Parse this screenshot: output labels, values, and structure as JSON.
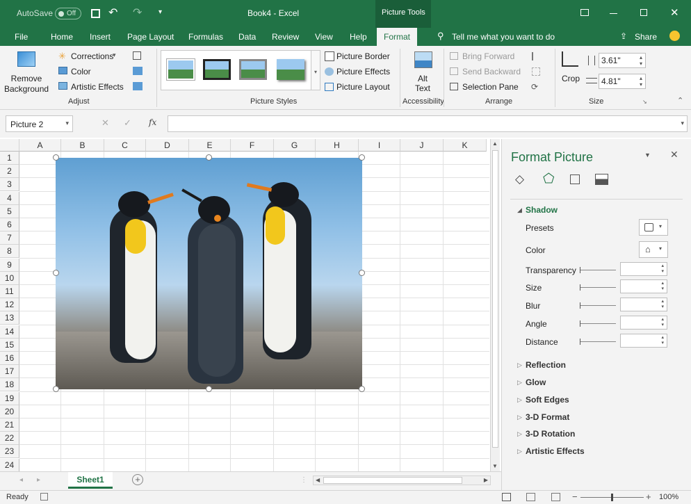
{
  "titlebar": {
    "autosave": "AutoSave",
    "autosave_state": "Off",
    "title": "Book4 - Excel",
    "context_tools": "Picture Tools"
  },
  "tabs": [
    "File",
    "Home",
    "Insert",
    "Page Layout",
    "Formulas",
    "Data",
    "Review",
    "View",
    "Help",
    "Format"
  ],
  "tell_me": "Tell me what you want to do",
  "share": "Share",
  "ribbon": {
    "remove_background": "Remove Background",
    "corrections": "Corrections",
    "color": "Color",
    "artistic_effects": "Artistic Effects",
    "adjust_label": "Adjust",
    "picture_styles_label": "Picture Styles",
    "picture_border": "Picture Border",
    "picture_effects": "Picture Effects",
    "picture_layout": "Picture Layout",
    "alt_text": "Alt Text",
    "accessibility_label": "Accessibility",
    "bring_forward": "Bring Forward",
    "send_backward": "Send Backward",
    "selection_pane": "Selection Pane",
    "arrange_label": "Arrange",
    "crop": "Crop",
    "height": "3.61\"",
    "width": "4.81\"",
    "size_label": "Size"
  },
  "formula_bar": {
    "name_box": "Picture 2",
    "fx": "fx",
    "value": ""
  },
  "columns": [
    "A",
    "B",
    "C",
    "D",
    "E",
    "F",
    "G",
    "H",
    "I",
    "J",
    "K"
  ],
  "rows": [
    "1",
    "2",
    "3",
    "4",
    "5",
    "6",
    "7",
    "8",
    "9",
    "10",
    "11",
    "12",
    "13",
    "14",
    "15",
    "16",
    "17",
    "18",
    "19",
    "20",
    "21",
    "22",
    "23",
    "24"
  ],
  "pane": {
    "title": "Format Picture",
    "shadow": "Shadow",
    "presets": "Presets",
    "color": "Color",
    "transparency": "Transparency",
    "size": "Size",
    "blur": "Blur",
    "angle": "Angle",
    "distance": "Distance",
    "reflection": "Reflection",
    "glow": "Glow",
    "soft_edges": "Soft Edges",
    "three_d_format": "3-D Format",
    "three_d_rotation": "3-D Rotation",
    "artistic_effects": "Artistic Effects"
  },
  "sheet_tab": "Sheet1",
  "status": {
    "ready": "Ready",
    "zoom": "100%"
  },
  "colors": {
    "brand": "#217346",
    "ribbon": "#f3f3f3",
    "grid": "#e1e1e1"
  }
}
